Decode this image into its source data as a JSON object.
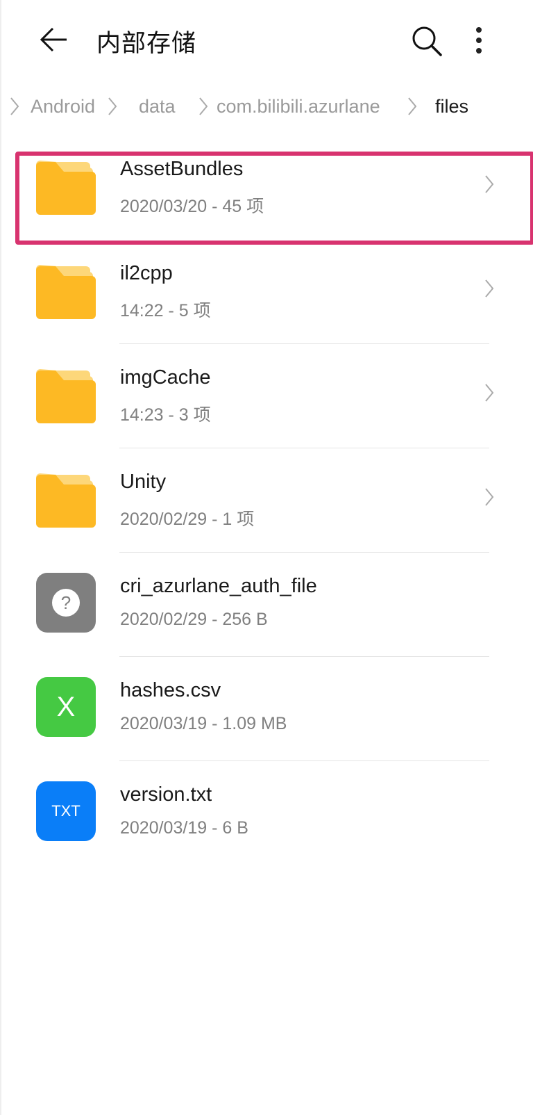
{
  "header": {
    "title": "内部存储",
    "back_icon": "arrow-left-icon",
    "search_icon": "search-icon",
    "more_icon": "more-vertical-icon"
  },
  "breadcrumb": [
    "Android",
    "data",
    "com.bilibili.azurlane",
    "files"
  ],
  "files": [
    {
      "name": "AssetBundles",
      "meta": "2020/03/20 - 45 项",
      "type": "folder"
    },
    {
      "name": "il2cpp",
      "meta": "14:22 - 5 项",
      "type": "folder"
    },
    {
      "name": "imgCache",
      "meta": "14:23 - 3 项",
      "type": "folder"
    },
    {
      "name": "Unity",
      "meta": "2020/02/29 - 1 项",
      "type": "folder"
    },
    {
      "name": "cri_azurlane_auth_file",
      "meta": "2020/02/29 - 256 B",
      "type": "unknown",
      "glyph": "?"
    },
    {
      "name": "hashes.csv",
      "meta": "2020/03/19 - 1.09 MB",
      "type": "excel",
      "glyph": "X"
    },
    {
      "name": "version.txt",
      "meta": "2020/03/19 - 6 B",
      "type": "text",
      "glyph": "TXT"
    }
  ],
  "colors": {
    "folder": "#fdb924",
    "folder_tab": "#fdd77a",
    "unknown": "#7f7f7f",
    "excel": "#45c943",
    "text": "#0a7ef8",
    "highlight": "#d8336f"
  }
}
